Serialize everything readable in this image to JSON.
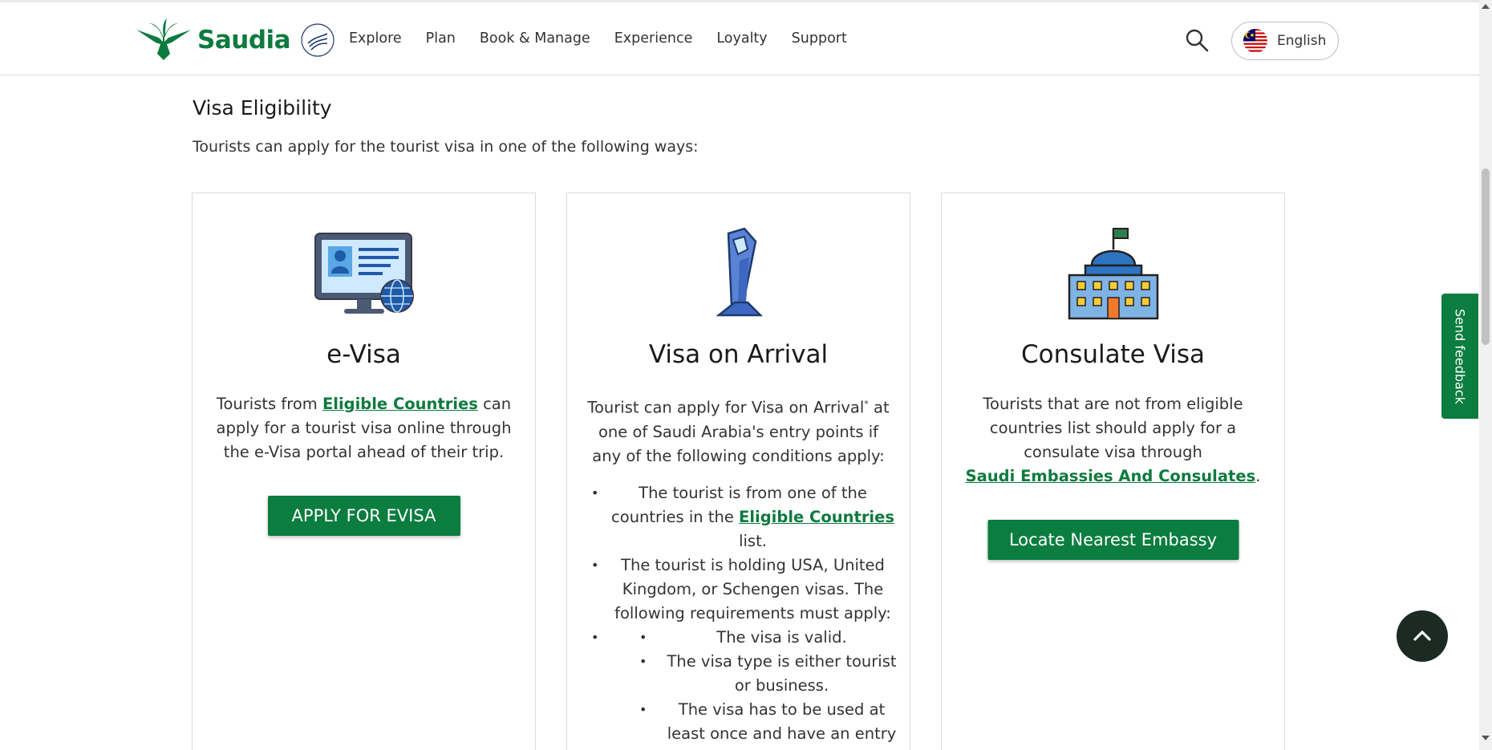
{
  "header": {
    "brand": "Saudia",
    "nav": [
      "Explore",
      "Plan",
      "Book & Manage",
      "Experience",
      "Loyalty",
      "Support"
    ],
    "language": "English",
    "icons": {
      "logo": "saudia-palm-logo",
      "skyteam": "skyteam-logo",
      "search": "search-icon",
      "flag": "malaysia-flag-icon"
    }
  },
  "section": {
    "title": "Visa Eligibility",
    "intro": "Tourists can apply for the tourist visa in one of the following ways:"
  },
  "cards": {
    "evisa": {
      "title": "e-Visa",
      "text_before": "Tourists from ",
      "link": "Eligible Countries",
      "text_after": " can apply for a tourist visa online through the e-Visa portal ahead of their trip.",
      "button": "APPLY FOR EVISA",
      "icon": "computer-id-globe-icon"
    },
    "arrival": {
      "title": "Visa on Arrival",
      "text_before": "Tourist can apply for Visa on Arrival",
      "sup": "*",
      "text_after": " at one of Saudi Arabia's entry points if any of the following conditions apply:",
      "item1_before": "The tourist is from one of the countries in the ",
      "item1_link": "Eligible Countries",
      "item1_after": " list.",
      "item2": "The tourist is holding USA, United Kingdom, or Schengen visas. The following requirements must apply:",
      "sub1": "The visa is valid.",
      "sub2": "The visa type is either tourist or business.",
      "sub3": "The visa has to be used at least once and have an entry stamp of the issuing",
      "icon": "kiosk-icon"
    },
    "consulate": {
      "title": "Consulate Visa",
      "text": "Tourists that are not from eligible countries list should apply for a consulate visa through",
      "link": "Saudi Embassies And Consulates",
      "link_after": ".",
      "button": "Locate Nearest Embassy",
      "icon": "embassy-building-icon"
    }
  },
  "floating": {
    "feedback": "Send feedback",
    "totop_icon": "chevron-up-icon"
  },
  "colors": {
    "brand_green": "#0a7d3f",
    "dark_button": "#1c2a24"
  }
}
